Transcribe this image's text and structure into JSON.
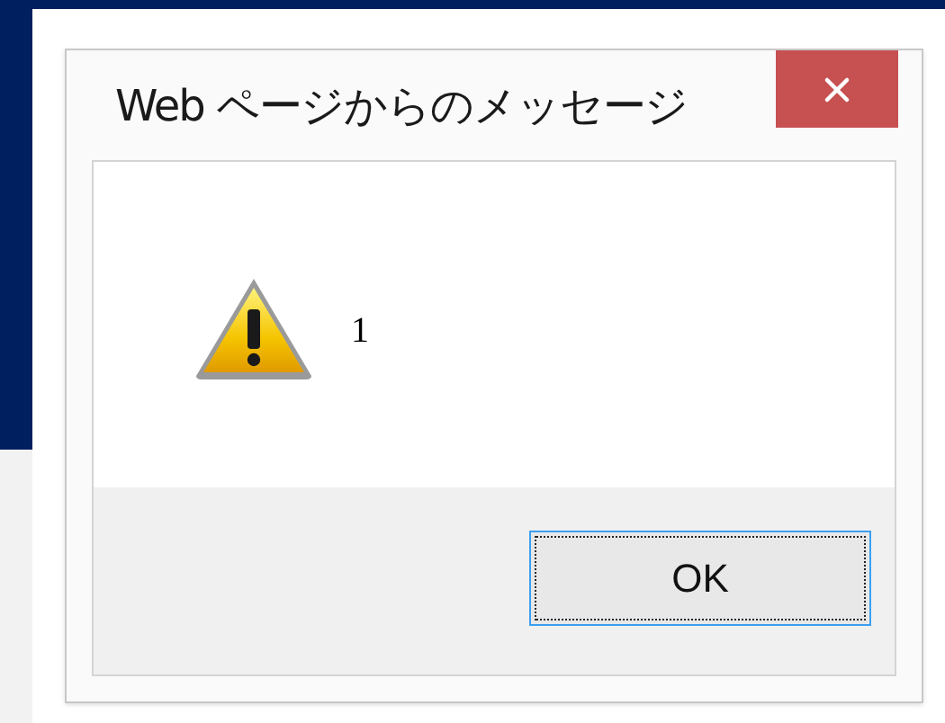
{
  "dialog": {
    "title": "Web ページからのメッセージ",
    "icon": {
      "kind": "warning"
    },
    "message": "1",
    "buttons": [
      {
        "label": "OK",
        "focused": true
      }
    ]
  }
}
